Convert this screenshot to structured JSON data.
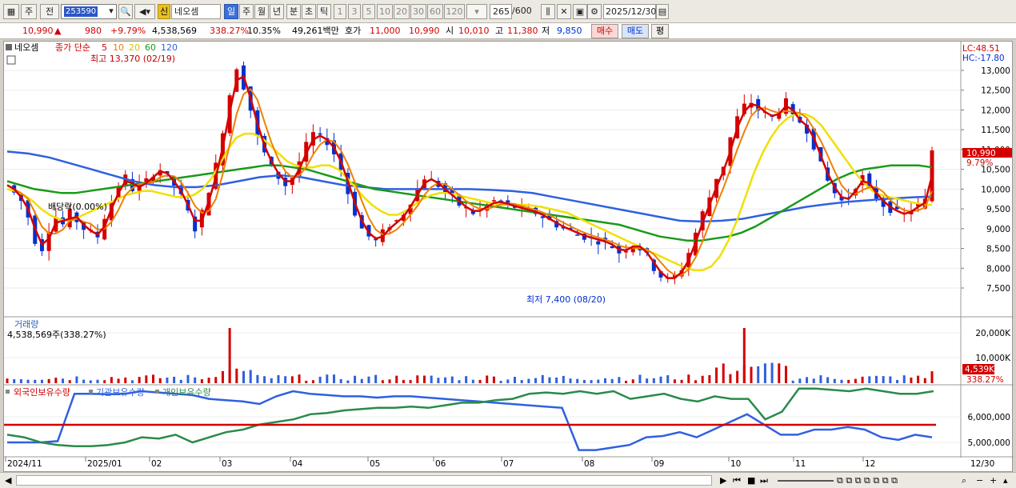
{
  "toolbar": {
    "tab_week": "주",
    "tab_prev": "전",
    "stock_code": "253590",
    "stock_name": "네오셈",
    "new_badge": "신",
    "periods": [
      "일",
      "주",
      "월",
      "년",
      "분",
      "초",
      "틱"
    ],
    "intervals": [
      "1",
      "3",
      "5",
      "10",
      "20",
      "30",
      "60",
      "120"
    ],
    "count": "265",
    "count_max": "/600",
    "date": "2025/12/30"
  },
  "quote": {
    "price": "10,990",
    "arrow": "▲",
    "change": "980",
    "change_pct": "+9.79%",
    "volume": "4,538,569",
    "vol_ratio": "338.27%",
    "turnover_pct": "10.35%",
    "amount": "49,261백만",
    "hoga_label": "호가",
    "ask": "11,000",
    "bid": "10,990",
    "open_label": "시",
    "open": "10,010",
    "high_label": "고",
    "high": "11,380",
    "low_label": "저",
    "low": "9,850",
    "buy": "매수",
    "sell": "매도",
    "avg": "평"
  },
  "legend": {
    "name": "네오셈",
    "close_type": "종가 단순",
    "ma": [
      "5",
      "10",
      "20",
      "60",
      "120"
    ]
  },
  "annotations": {
    "high": "최고 13,370 (02/19)",
    "low": "최저 7,400 (08/20)",
    "dividend": "배당락(0.00%)",
    "lc": "LC:48.51",
    "hc": "HC:-17.80",
    "price_tag": "10,990",
    "pct_tag": "9.79%",
    "vol_title": "거래량",
    "vol_value": "4,538,569주(338.27%)",
    "vol_tag": "4,539K",
    "vol_pct_tag": "338.27%"
  },
  "holdings_legend": [
    "외국인보유수량",
    "기관보유수량",
    "개인보유수량"
  ],
  "axes": {
    "price_ticks": [
      "13,000",
      "12,500",
      "12,000",
      "11,500",
      "11,000",
      "10,500",
      "10,000",
      "9,500",
      "9,000",
      "8,500",
      "8,000",
      "7,500"
    ],
    "volume_ticks": [
      "20,000K",
      "10,000K"
    ],
    "holding_ticks": [
      "6,000,000",
      "5,000,000"
    ],
    "x_labels": [
      "2024/11",
      "2025/01",
      "02",
      "03",
      "04",
      "05",
      "06",
      "07",
      "08",
      "09",
      "10",
      "11",
      "12"
    ],
    "x_last": "12/30"
  },
  "colors": {
    "up": "#d40000",
    "down": "#0030d0",
    "ma5": "#d40000",
    "ma10": "#f08000",
    "ma20": "#f0e000",
    "ma60": "#1a9a1a",
    "ma120": "#3060e0",
    "foreign": "#3060e0",
    "inst": "#2a8a4a"
  },
  "chart_data": {
    "type": "candlestick",
    "price_range": [
      7200,
      13400
    ],
    "close_series": [
      10100,
      9900,
      9700,
      9300,
      8700,
      8500,
      9000,
      9300,
      9100,
      9400,
      9200,
      9000,
      8900,
      8800,
      9300,
      9700,
      10100,
      10300,
      10000,
      10100,
      10200,
      10400,
      10500,
      10300,
      10100,
      9800,
      9400,
      9000,
      9400,
      10000,
      10600,
      11500,
      12400,
      13100,
      12600,
      12000,
      11300,
      10900,
      10500,
      10300,
      10100,
      10300,
      10700,
      11100,
      11400,
      11300,
      11200,
      10900,
      10500,
      9900,
      9400,
      9000,
      8800,
      8700,
      8900,
      9100,
      9200,
      9400,
      9700,
      10000,
      10300,
      10200,
      10100,
      9900,
      9800,
      9600,
      9500,
      9400,
      9500,
      9600,
      9700,
      9650,
      9600,
      9550,
      9500,
      9450,
      9400,
      9300,
      9200,
      9100,
      9000,
      8950,
      8850,
      8800,
      8750,
      8700,
      8650,
      8550,
      8400,
      8500,
      8600,
      8500,
      8300,
      8000,
      7800,
      7700,
      7800,
      8000,
      8400,
      8900,
      9400,
      9800,
      10300,
      10600,
      11300,
      11800,
      12100,
      12200,
      12000,
      11900,
      11800,
      12000,
      12200,
      11800,
      11700,
      11500,
      11100,
      10600,
      10200,
      9900,
      9700,
      9800,
      10100,
      10300,
      10000,
      9800,
      9600,
      9500,
      9400,
      9350,
      9500,
      9600,
      9700,
      10990
    ],
    "ma20_series": [
      10000,
      9950,
      9850,
      9700,
      9500,
      9350,
      9250,
      9200,
      9250,
      9350,
      9450,
      9550,
      9650,
      9750,
      9850,
      9900,
      9950,
      9950,
      9900,
      9850,
      9800,
      9800,
      9850,
      10000,
      10250,
      10600,
      11000,
      11300,
      11400,
      11400,
      11300,
      11100,
      10900,
      10700,
      10600,
      10550,
      10550,
      10600,
      10600,
      10500,
      10300,
      10050,
      9800,
      9600,
      9450,
      9350,
      9350,
      9450,
      9600,
      9750,
      9850,
      9900,
      9900,
      9850,
      9800,
      9750,
      9700,
      9650,
      9600,
      9600,
      9600,
      9600,
      9580,
      9550,
      9500,
      9450,
      9400,
      9300,
      9200,
      9100,
      9000,
      8900,
      8800,
      8700,
      8600,
      8500,
      8400,
      8300,
      8200,
      8100,
      8000,
      7950,
      7950,
      8050,
      8300,
      8700,
      9200,
      9800,
      10400,
      10900,
      11300,
      11600,
      11800,
      11900,
      11900,
      11800,
      11600,
      11300,
      11000,
      10700,
      10400,
      10150,
      9950,
      9850,
      9800,
      9750,
      9700,
      9650,
      9620,
      9600
    ],
    "ma60_series": [
      10200,
      10100,
      10000,
      9950,
      9900,
      9900,
      9950,
      10000,
      10050,
      10100,
      10150,
      10200,
      10250,
      10300,
      10350,
      10400,
      10450,
      10500,
      10550,
      10600,
      10600,
      10550,
      10500,
      10400,
      10300,
      10200,
      10100,
      10000,
      9950,
      9900,
      9850,
      9800,
      9750,
      9700,
      9650,
      9600,
      9550,
      9500,
      9450,
      9400,
      9350,
      9300,
      9250,
      9200,
      9150,
      9100,
      9000,
      8900,
      8800,
      8750,
      8700,
      8700,
      8750,
      8800,
      8900,
      9050,
      9250,
      9450,
      9650,
      9850,
      10050,
      10250,
      10400,
      10500,
      10550,
      10600,
      10600,
      10600,
      10550
    ],
    "ma120_series": [
      10950,
      10900,
      10800,
      10650,
      10500,
      10350,
      10200,
      10100,
      10050,
      10050,
      10100,
      10200,
      10300,
      10350,
      10300,
      10200,
      10100,
      10050,
      10000,
      10000,
      10000,
      10000,
      10000,
      9980,
      9950,
      9900,
      9800,
      9700,
      9600,
      9500,
      9400,
      9300,
      9200,
      9180,
      9200,
      9250,
      9350,
      9450,
      9550,
      9620,
      9680,
      9720,
      9760,
      9790,
      9810
    ],
    "volume_spikes": [
      {
        "x": "02/19",
        "value": 21000
      },
      {
        "x": "10",
        "value": 21000
      },
      {
        "x": "12/30",
        "value": 4539
      }
    ],
    "holding_range": [
      4700000,
      7000000
    ]
  }
}
